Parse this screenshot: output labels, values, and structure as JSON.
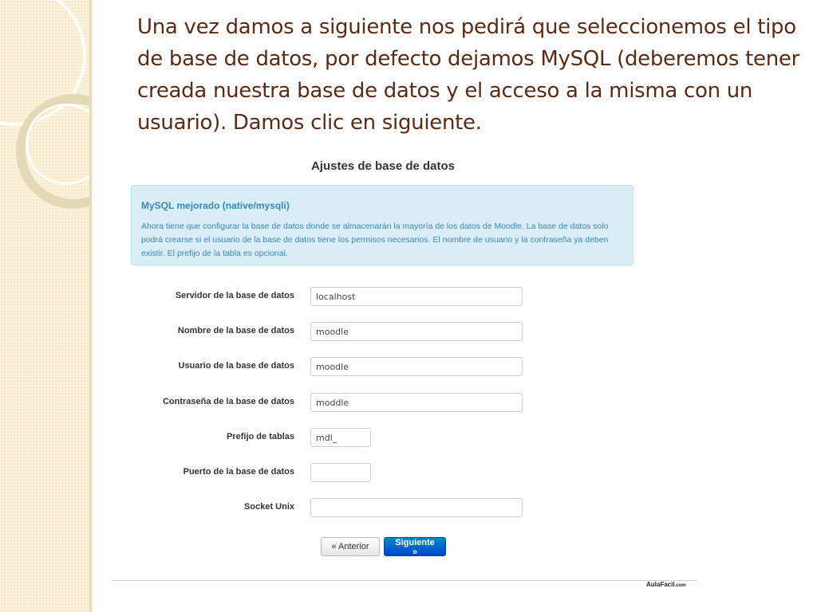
{
  "slide": {
    "text": "Una vez damos a siguiente nos pedirá que seleccionemos el tipo de base de datos, por defecto dejamos MySQL (deberemos tener creada nuestra base de datos y el acceso a la misma con un usuario). Damos clic en siguiente."
  },
  "form": {
    "title": "Ajustes de base de datos",
    "info_heading": "MySQL mejorado (native/mysqli)",
    "info_text": "Ahora tiene que configurar la base de datos donde se almacenarán la mayoría de los datos de Moodle. La base de datos solo podrá crearse si el usuario de la base de datos tiene los permisos necesarios. El nombre de usuario y la contraseña ya deben existir. El prefijo de la tabla es opcional.",
    "fields": [
      {
        "label": "Servidor de la base de datos",
        "value": "localhost"
      },
      {
        "label": "Nombre de la base de datos",
        "value": "moodle"
      },
      {
        "label": "Usuario de la base de datos",
        "value": "moodle"
      },
      {
        "label": "Contraseña de la base de datos",
        "value": "moddle"
      },
      {
        "label": "Prefijo de tablas",
        "value": "mdl_"
      },
      {
        "label": "Puerto de la base de datos",
        "value": ""
      },
      {
        "label": "Socket Unix",
        "value": ""
      }
    ],
    "buttons": {
      "previous": "« Anterior",
      "next": "Siguiente »"
    }
  },
  "footer": {
    "brand": "AulaFacil",
    "brand_suffix": ".com"
  },
  "colors": {
    "slide_text": "#5a2b16",
    "info_bg": "#d9edf7",
    "info_text": "#3a87ad",
    "primary_button": "#0055cc",
    "band": "#f7eccb"
  }
}
